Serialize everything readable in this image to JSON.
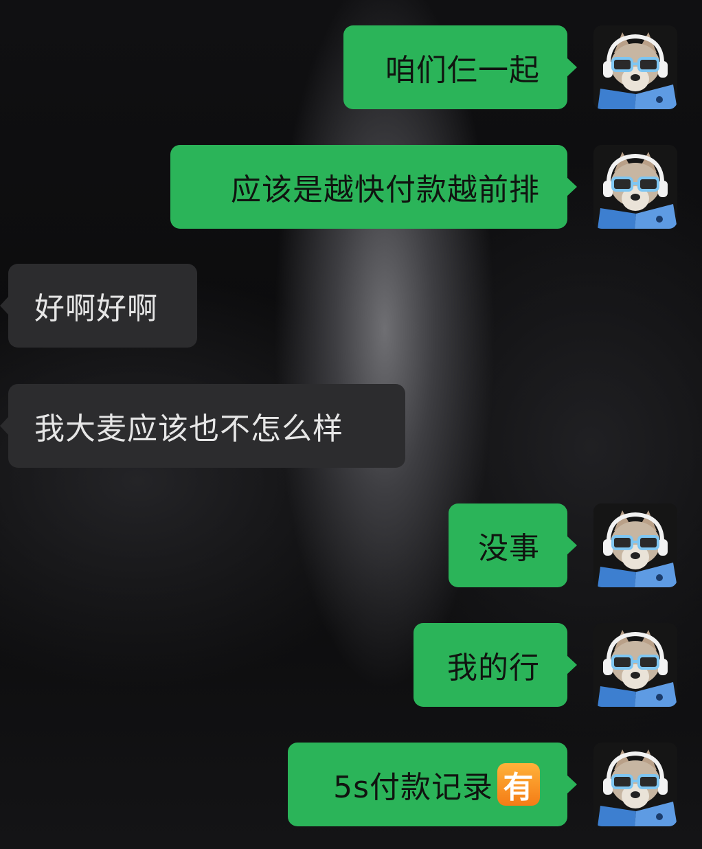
{
  "messages": [
    {
      "side": "out",
      "text": "咱们仨一起"
    },
    {
      "side": "out",
      "text": "应该是越快付款越前排"
    },
    {
      "side": "in",
      "text": "好啊好啊"
    },
    {
      "side": "in",
      "text": "我大麦应该也不怎么样"
    },
    {
      "side": "out",
      "text": "没事"
    },
    {
      "side": "out",
      "text": "我的行"
    },
    {
      "side": "out",
      "text": "5s付款记录",
      "emoji": "有"
    }
  ],
  "colors": {
    "outgoing_bubble": "#2bb459",
    "incoming_bubble": "#2c2c2e",
    "incoming_text": "#e6e6e6",
    "outgoing_text": "#101410"
  },
  "avatar_icon": "husky-dog-with-headphones-sunglasses-reading-book"
}
